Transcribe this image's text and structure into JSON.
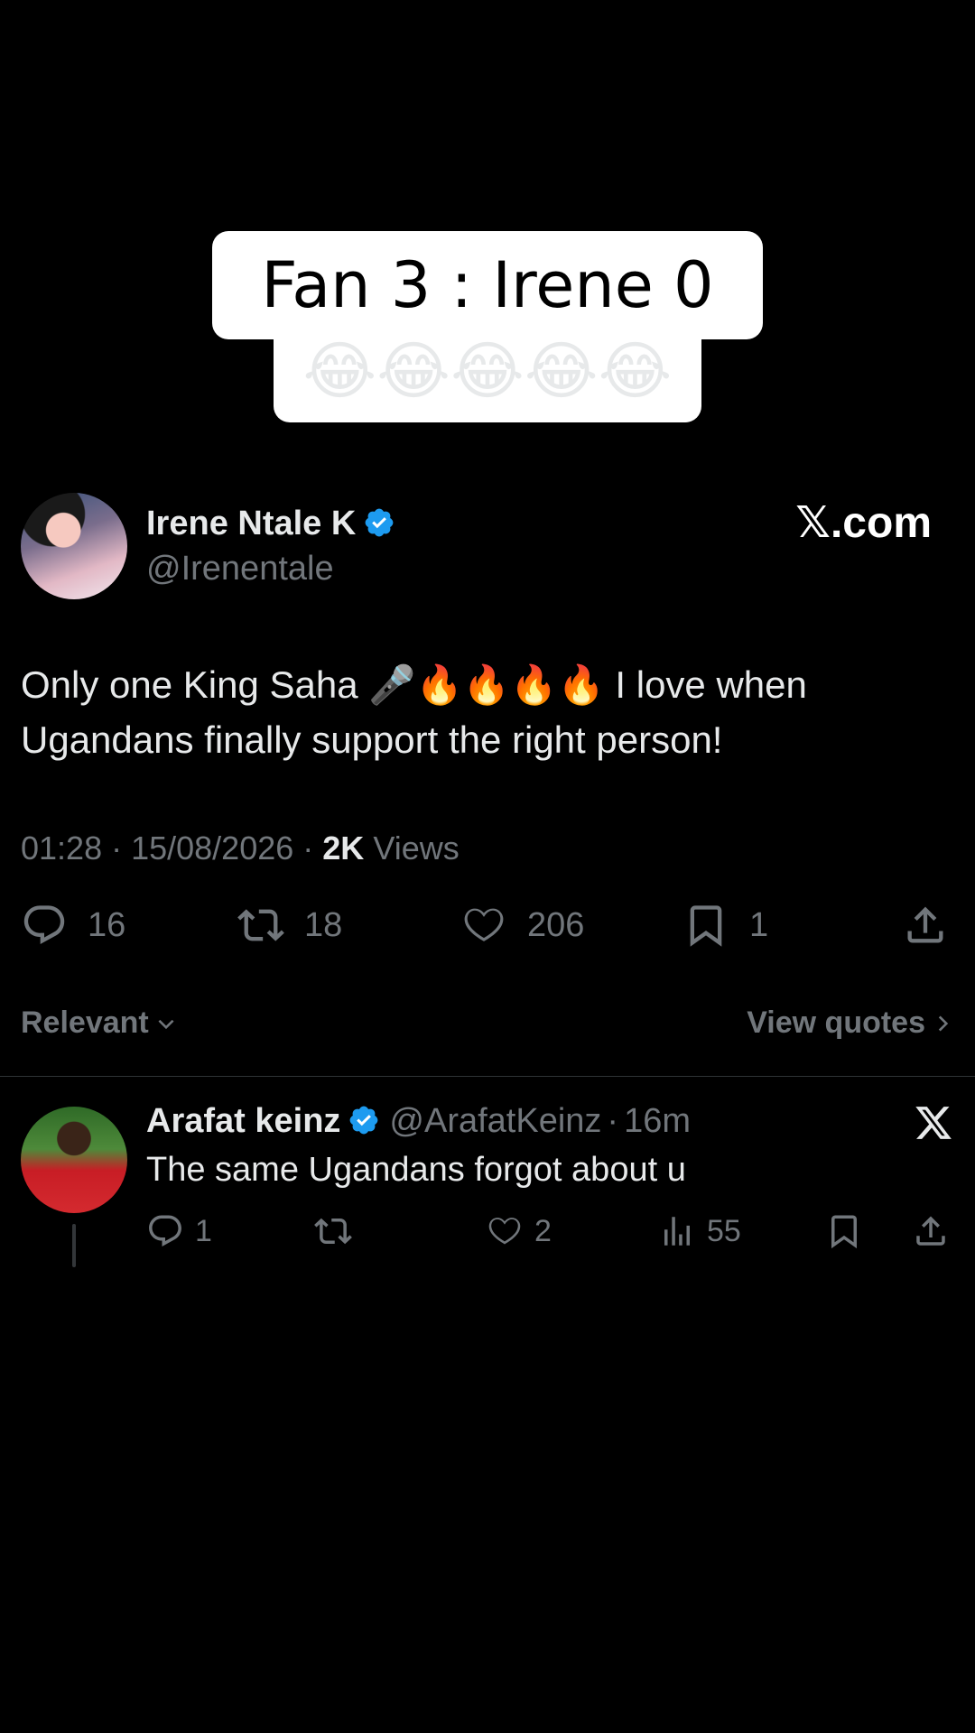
{
  "caption": {
    "line1": "Fan 3 : Irene 0",
    "line2": "😂😂😂😂😂"
  },
  "brand": {
    "site": "𝕏.com"
  },
  "tweet": {
    "author_name": "Irene Ntale K",
    "author_handle": "@Irenentale",
    "text": "Only one King Saha 🎤🔥🔥🔥🔥 I love when Ugandans finally support the right person!",
    "time": "01:28",
    "date": "15/08/2026",
    "views_count": "2K",
    "views_label": "Views",
    "replies": "16",
    "reposts": "18",
    "likes": "206",
    "bookmarks": "1"
  },
  "sort": {
    "label": "Relevant",
    "view_quotes": "View quotes"
  },
  "reply": {
    "author_name": "Arafat keinz",
    "author_handle": "@ArafatKeinz",
    "age": "16m",
    "text": "The same Ugandans forgot about u",
    "replies": "1",
    "reposts": "",
    "likes": "2",
    "views": "55"
  },
  "colors": {
    "background": "#000000",
    "text": "#e7e9ea",
    "muted": "#71767b",
    "verified": "#1d9bf0"
  },
  "icons": [
    "verified-icon",
    "reply-icon",
    "repost-icon",
    "like-icon",
    "bookmark-icon",
    "share-icon",
    "views-icon",
    "x-logo-icon",
    "chevron-down-icon",
    "chevron-right-icon"
  ]
}
